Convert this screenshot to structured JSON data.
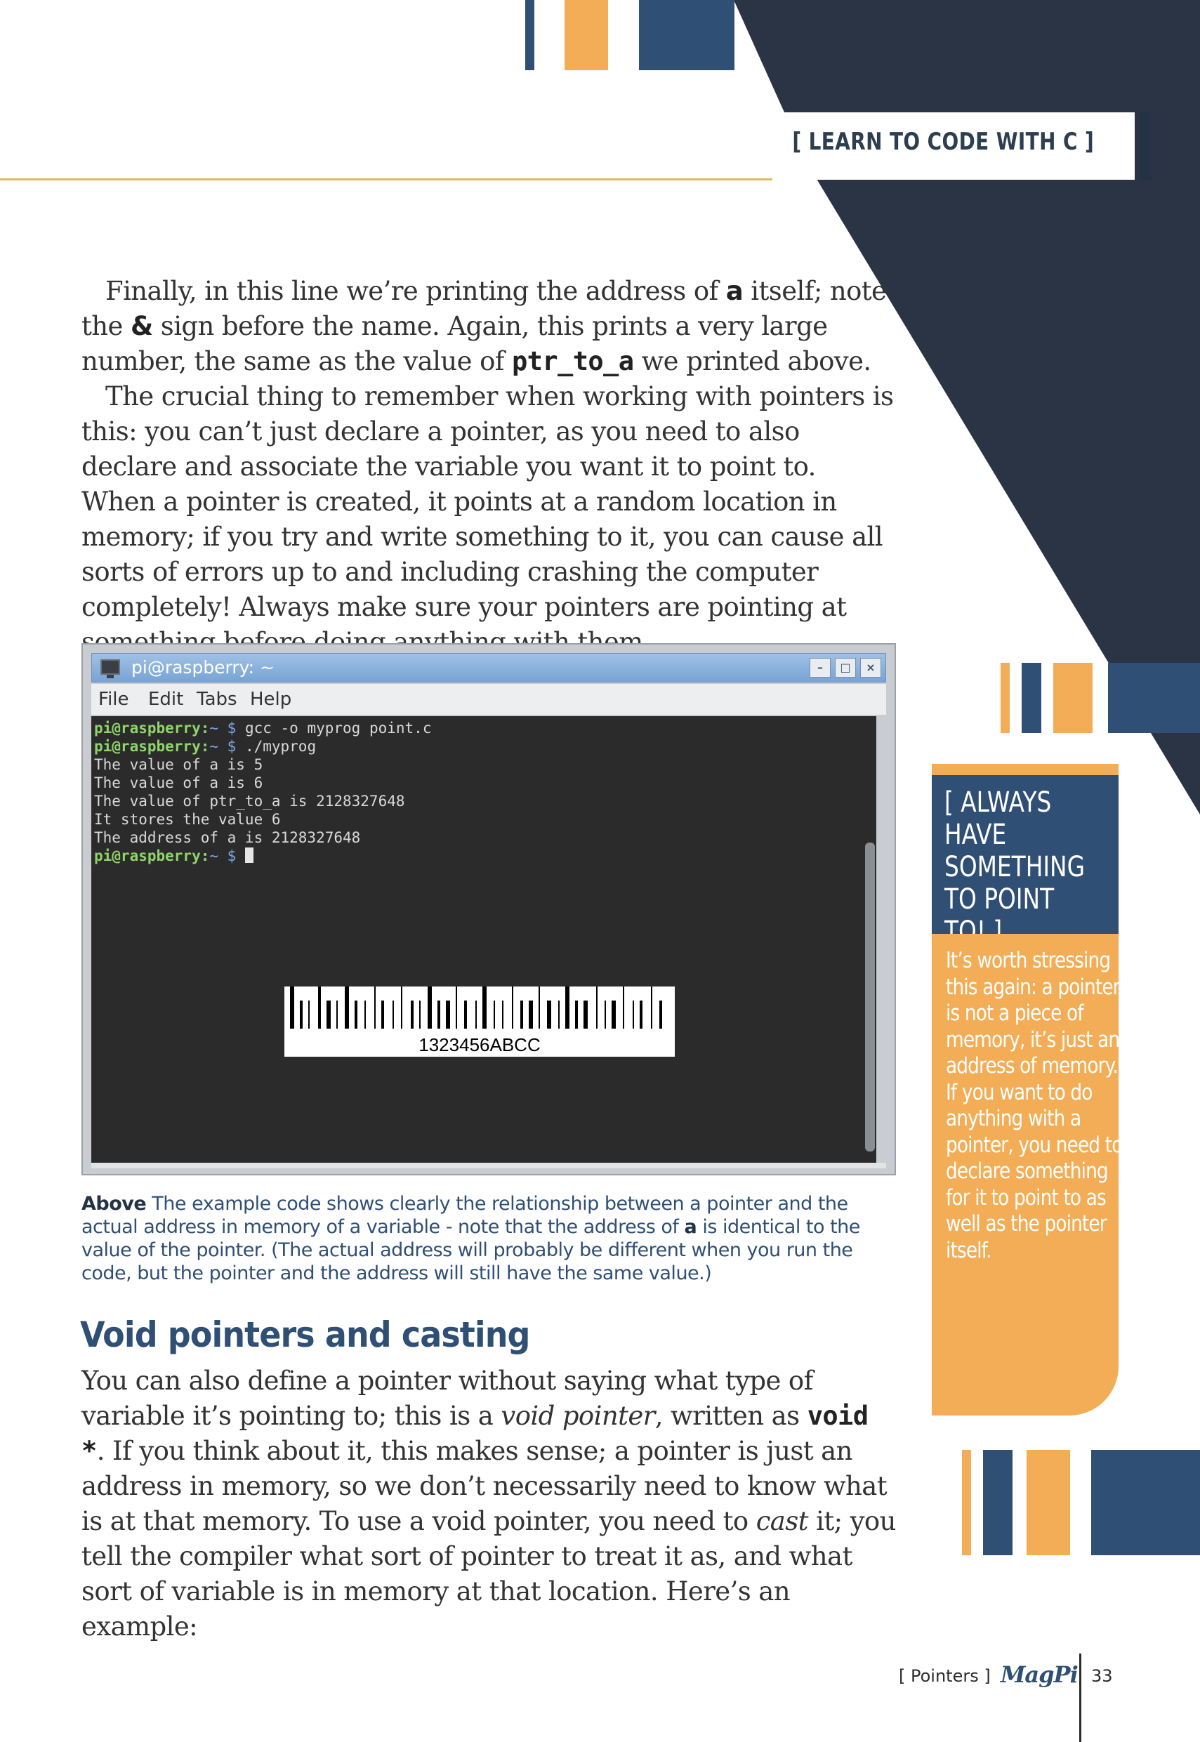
{
  "header": {
    "section_title": "[ LEARN TO CODE WITH C ]"
  },
  "intro": {
    "p1": {
      "t1": "Finally, in this line we’re printing the address of ",
      "var_a": "a",
      "t2": " itself; note the ",
      "amp": "&",
      "t3": " sign before the name. Again, this prints a very large number, the same as the value of ",
      "ptr": "ptr_to_a",
      "t4": " we printed above."
    },
    "p2": "The crucial thing to remember when working with pointers is this: you can’t just declare a pointer, as you need to also declare and associate the variable you want it to point to. When a pointer is created, it points at a random location in memory; if you try and write something to it, you can cause all sorts of errors up to and including crashing the computer completely! Always make sure your pointers are pointing at something before doing anything with them."
  },
  "terminal": {
    "window_title": "pi@raspberry: ~",
    "menu": [
      "File",
      "Edit",
      "Tabs",
      "Help"
    ],
    "buttons": {
      "minimize": "–",
      "maximize": "□",
      "close": "×"
    },
    "prompt_user": "pi@raspberry:",
    "prompt_path": "~",
    "prompt_dollar": "$",
    "lines": [
      {
        "type": "cmd",
        "text": "gcc -o myprog point.c"
      },
      {
        "type": "cmd",
        "text": "./myprog"
      },
      {
        "type": "out",
        "text": "The value of a is 5"
      },
      {
        "type": "out",
        "text": "The value of a is 6"
      },
      {
        "type": "out",
        "text": "The value of ptr_to_a is 2128327648"
      },
      {
        "type": "out",
        "text": "It stores the value 6"
      },
      {
        "type": "out",
        "text": "The address of a is 2128327648"
      },
      {
        "type": "prompt",
        "text": ""
      }
    ]
  },
  "barcode": {
    "text": "1323456ABCC"
  },
  "caption": {
    "label": "Above",
    "t1": " The example code shows clearly the relationship between a pointer and the actual address in memory of a variable - note that the address of ",
    "var_a": "a",
    "t2": " is identical to the value of the pointer. (The actual address will probably be different when you run the code, but the pointer and the address will still have the same value.)"
  },
  "section": {
    "heading": "Void pointers and casting",
    "t1": "You can also define a pointer without saying what type of variable it’s pointing to; this is a ",
    "void_pointer": "void pointer",
    "t2": ", written as ",
    "code": "void *",
    "t3": ". If you think about it, this makes sense; a pointer is just an address in memory, so we don’t necessarily need to know what is at that memory. To use a void pointer, you need to ",
    "cast": "cast",
    "t4": " it; you tell the compiler what sort of pointer to treat it as, and what sort of variable is in memory at that location. Here’s an example:"
  },
  "sidebar": {
    "heading": "[ ALWAYS HAVE SOMETHING TO POINT TO! ]",
    "body": "It’s worth stressing this again: a pointer is not a piece of memory, it’s just an address of memory. If you want to do anything with a pointer, you need to declare something for it to point to as well as the pointer itself."
  },
  "footer": {
    "section": "[ Pointers ]",
    "magazine": "MagPi",
    "page_number": "33"
  },
  "colors": {
    "navy": "#2f4f75",
    "dark_navy": "#2a3445",
    "orange": "#f2ad56",
    "gold_rule": "#e8b45a"
  }
}
